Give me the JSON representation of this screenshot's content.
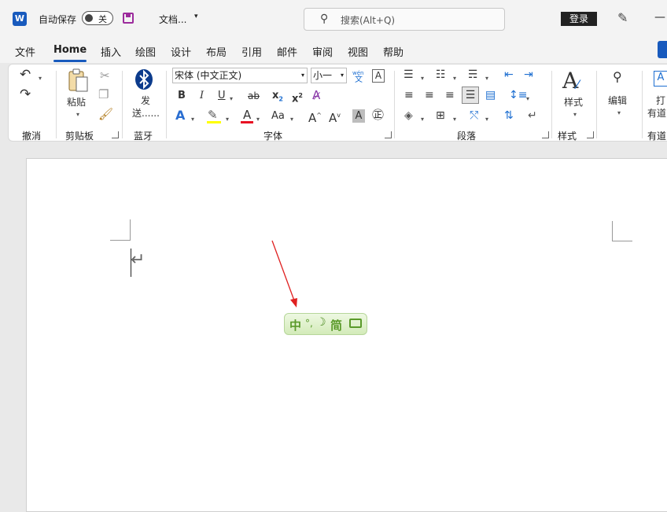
{
  "titlebar": {
    "app_logo": "W",
    "autosave_label": "自动保存",
    "autosave_state": "关",
    "doc_title": "文档...",
    "search_placeholder": "搜索(Alt+Q)",
    "login_label": "登录",
    "minimize": "—"
  },
  "menu": [
    "文件",
    "Home",
    "插入",
    "绘图",
    "设计",
    "布局",
    "引用",
    "邮件",
    "审阅",
    "视图",
    "帮助"
  ],
  "ribbon": {
    "undo_group": "撤消",
    "clipboard_group": "剪贴板",
    "paste_label": "粘贴",
    "bluetooth_label": "发送......",
    "bluetooth_group": "蓝牙",
    "font_name": "宋体 (中文正文)",
    "font_size": "小一",
    "phonetic_top": "wén",
    "phonetic_bottom": "文",
    "font_group": "字体",
    "bold": "B",
    "italic": "I",
    "underline": "U",
    "strike": "ab",
    "subscript": "x",
    "subscript_small": "2",
    "superscript": "x",
    "superscript_small": "2",
    "text_effect": "A",
    "font_color": "A",
    "change_case": "Aa",
    "grow_font": "A",
    "shrink_font": "A",
    "char_shade": "A",
    "paragraph_group": "段落",
    "styles_label": "样式",
    "styles_group": "样式",
    "editing_label": "编辑",
    "youdao_label_1": "打",
    "youdao_label_2": "有道",
    "youdao_group": "有道"
  },
  "ime": {
    "mode": "中",
    "jian": "简"
  },
  "colors": {
    "accent": "#185abd",
    "highlight": "#ffff00",
    "font_color": "#e81123",
    "ime_green": "#5a9a2a"
  }
}
